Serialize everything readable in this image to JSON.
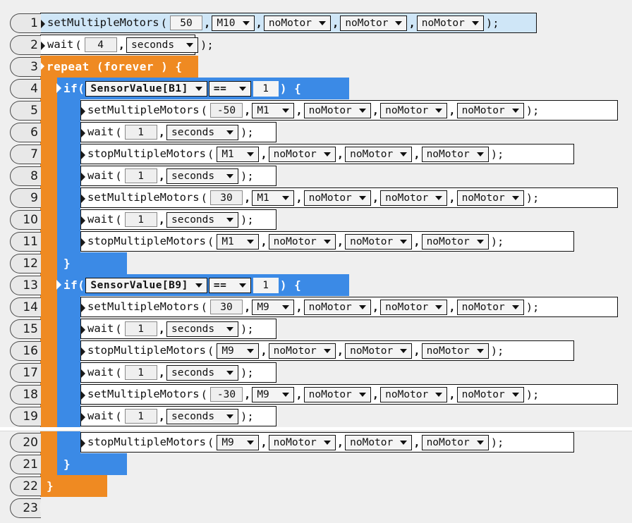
{
  "app": {
    "title": "Block Code Editor",
    "background_color": "#efefef",
    "repeat_block_color": "#ef8a22",
    "if_block_color": "#3b8ae6",
    "selected_row_color": "#cfe6f7"
  },
  "tokens": {
    "setMultipleMotors": "setMultipleMotors",
    "stopMultipleMotors": "stopMultipleMotors",
    "wait": "wait",
    "repeat": "repeat",
    "forever": "forever",
    "if": "if",
    "open_paren": "(",
    "close_paren": ")",
    "close_stmt": ");",
    "comma": ",",
    "open_brace": "{",
    "close_brace": "}",
    "noMotor": "noMotor",
    "seconds": "seconds",
    "equals_op": "==",
    "repeat_header": "repeat (forever ) {",
    "if_word": "if",
    "if_open": "("
  },
  "lines": [
    {
      "number": "1",
      "kind": "statement",
      "selected": true,
      "indent": 0,
      "func": "setMultipleMotors",
      "value": "50",
      "motors": [
        "M10",
        "noMotor",
        "noMotor",
        "noMotor"
      ]
    },
    {
      "number": "2",
      "kind": "wait",
      "selected": false,
      "indent": 0,
      "func": "wait",
      "value": "4",
      "unit": "seconds"
    },
    {
      "number": "3",
      "kind": "repeat-open",
      "indent": 0,
      "text": "repeat (forever ) {"
    },
    {
      "number": "4",
      "kind": "if-open",
      "indent": 1,
      "condition_var": "SensorValue[B1]",
      "operator": "==",
      "compare_value": "1"
    },
    {
      "number": "5",
      "kind": "statement",
      "indent": 2,
      "func": "setMultipleMotors",
      "value": "-50",
      "motors": [
        "M1",
        "noMotor",
        "noMotor",
        "noMotor"
      ]
    },
    {
      "number": "6",
      "kind": "wait",
      "indent": 2,
      "func": "wait",
      "value": "1",
      "unit": "seconds"
    },
    {
      "number": "7",
      "kind": "stop",
      "indent": 2,
      "func": "stopMultipleMotors",
      "motors": [
        "M1",
        "noMotor",
        "noMotor",
        "noMotor"
      ]
    },
    {
      "number": "8",
      "kind": "wait",
      "indent": 2,
      "func": "wait",
      "value": "1",
      "unit": "seconds"
    },
    {
      "number": "9",
      "kind": "statement",
      "indent": 2,
      "func": "setMultipleMotors",
      "value": "30",
      "motors": [
        "M1",
        "noMotor",
        "noMotor",
        "noMotor"
      ]
    },
    {
      "number": "10",
      "kind": "wait",
      "indent": 2,
      "func": "wait",
      "value": "1",
      "unit": "seconds"
    },
    {
      "number": "11",
      "kind": "stop",
      "indent": 2,
      "func": "stopMultipleMotors",
      "motors": [
        "M1",
        "noMotor",
        "noMotor",
        "noMotor"
      ]
    },
    {
      "number": "12",
      "kind": "if-close",
      "indent": 1,
      "text": "}"
    },
    {
      "number": "13",
      "kind": "if-open",
      "indent": 1,
      "condition_var": "SensorValue[B9]",
      "operator": "==",
      "compare_value": "1"
    },
    {
      "number": "14",
      "kind": "statement",
      "indent": 2,
      "func": "setMultipleMotors",
      "value": "30",
      "motors": [
        "M9",
        "noMotor",
        "noMotor",
        "noMotor"
      ]
    },
    {
      "number": "15",
      "kind": "wait",
      "indent": 2,
      "func": "wait",
      "value": "1",
      "unit": "seconds"
    },
    {
      "number": "16",
      "kind": "stop",
      "indent": 2,
      "func": "stopMultipleMotors",
      "motors": [
        "M9",
        "noMotor",
        "noMotor",
        "noMotor"
      ]
    },
    {
      "number": "17",
      "kind": "wait",
      "indent": 2,
      "func": "wait",
      "value": "1",
      "unit": "seconds"
    },
    {
      "number": "18",
      "kind": "statement",
      "indent": 2,
      "func": "setMultipleMotors",
      "value": "-30",
      "motors": [
        "M9",
        "noMotor",
        "noMotor",
        "noMotor"
      ]
    },
    {
      "number": "19",
      "kind": "wait",
      "indent": 2,
      "func": "wait",
      "value": "1",
      "unit": "seconds"
    },
    {
      "number": "20",
      "kind": "stop",
      "indent": 2,
      "func": "stopMultipleMotors",
      "motors": [
        "M9",
        "noMotor",
        "noMotor",
        "noMotor"
      ]
    },
    {
      "number": "21",
      "kind": "if-close",
      "indent": 1,
      "text": "}"
    },
    {
      "number": "22",
      "kind": "repeat-close",
      "indent": 0,
      "text": "}"
    },
    {
      "number": "23",
      "kind": "empty",
      "indent": 0
    }
  ]
}
